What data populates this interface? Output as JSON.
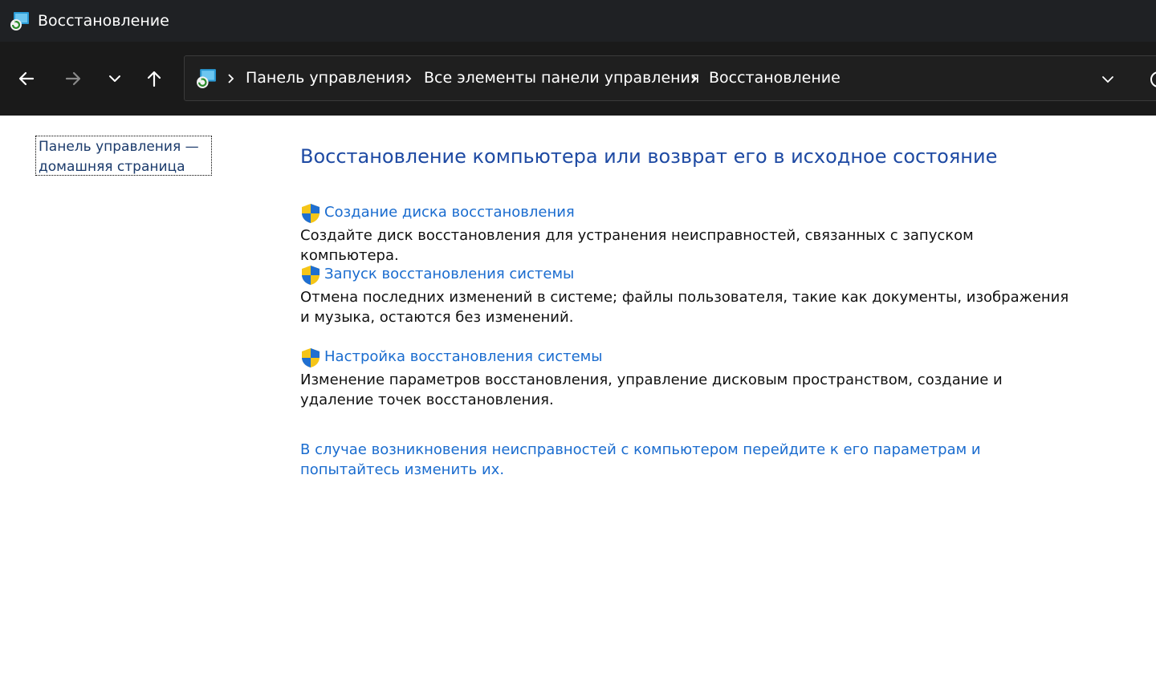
{
  "window": {
    "title": "Восстановление",
    "app_icon": "recovery-icon"
  },
  "nav": {
    "back_icon": "arrow-left-icon",
    "forward_icon": "arrow-right-icon",
    "recent_icon": "chevron-down-icon",
    "up_icon": "arrow-up-icon"
  },
  "address": {
    "crumbs": [
      "Панель управления",
      "Все элементы панели управления",
      "Восстановление"
    ]
  },
  "sidebar": {
    "home_link_line1": "Панель управления —",
    "home_link_line2": "домашняя страница"
  },
  "main": {
    "title": "Восстановление компьютера или возврат его в исходное состояние",
    "tasks": [
      {
        "label": "Создание диска восстановления",
        "description": "Создайте диск восстановления для устранения неисправностей, связанных с запуском компьютера."
      },
      {
        "label": "Запуск восстановления системы",
        "description": "Отмена последних изменений в системе; файлы пользователя, такие как документы, изображения и музыка, остаются без изменений."
      },
      {
        "label": "Настройка восстановления системы",
        "description": "Изменение параметров восстановления, управление дисковым пространством, создание и удаление точек восстановления."
      }
    ],
    "bottom_link": "В случае возникновения неисправностей с компьютером перейдите к его параметрам и попытайтесь изменить их."
  },
  "colors": {
    "titlebar_bg": "#1f2124",
    "navbar_bg": "#1a1a1a",
    "title_blue": "#1e4aa3",
    "link_blue": "#1a6ccf"
  }
}
